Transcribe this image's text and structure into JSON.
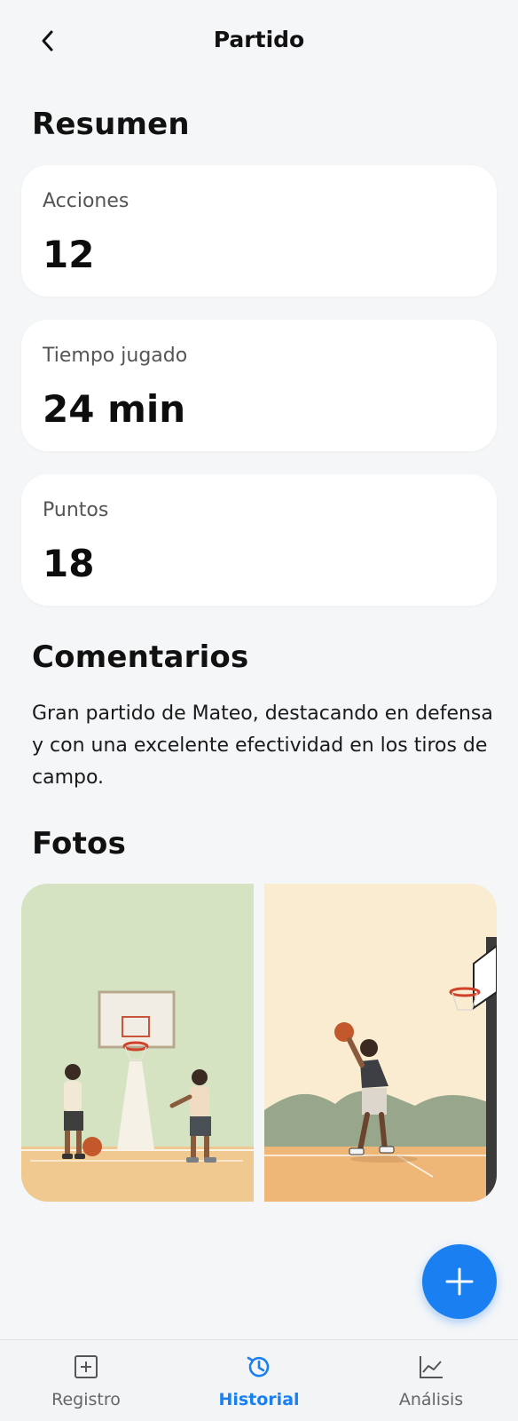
{
  "header": {
    "title": "Partido"
  },
  "summary": {
    "title": "Resumen",
    "cards": [
      {
        "label": "Acciones",
        "value": "12"
      },
      {
        "label": "Tiempo jugado",
        "value": "24 min"
      },
      {
        "label": "Puntos",
        "value": "18"
      }
    ]
  },
  "comments": {
    "title": "Comentarios",
    "text": "Gran partido de Mateo, destacando en defensa y con una excelente efectividad en los tiros de campo."
  },
  "photos": {
    "title": "Fotos",
    "items": [
      {
        "icon": "basketball-duel-photo"
      },
      {
        "icon": "basketball-free-throw-photo"
      }
    ]
  },
  "fab": {
    "icon": "plus-icon"
  },
  "bottom_nav": {
    "active_color": "#1a7ff0",
    "items": [
      {
        "label": "Registro",
        "icon": "plus-square-icon",
        "active": false
      },
      {
        "label": "Historial",
        "icon": "history-icon",
        "active": true
      },
      {
        "label": "Análisis",
        "icon": "line-chart-icon",
        "active": false
      }
    ]
  }
}
